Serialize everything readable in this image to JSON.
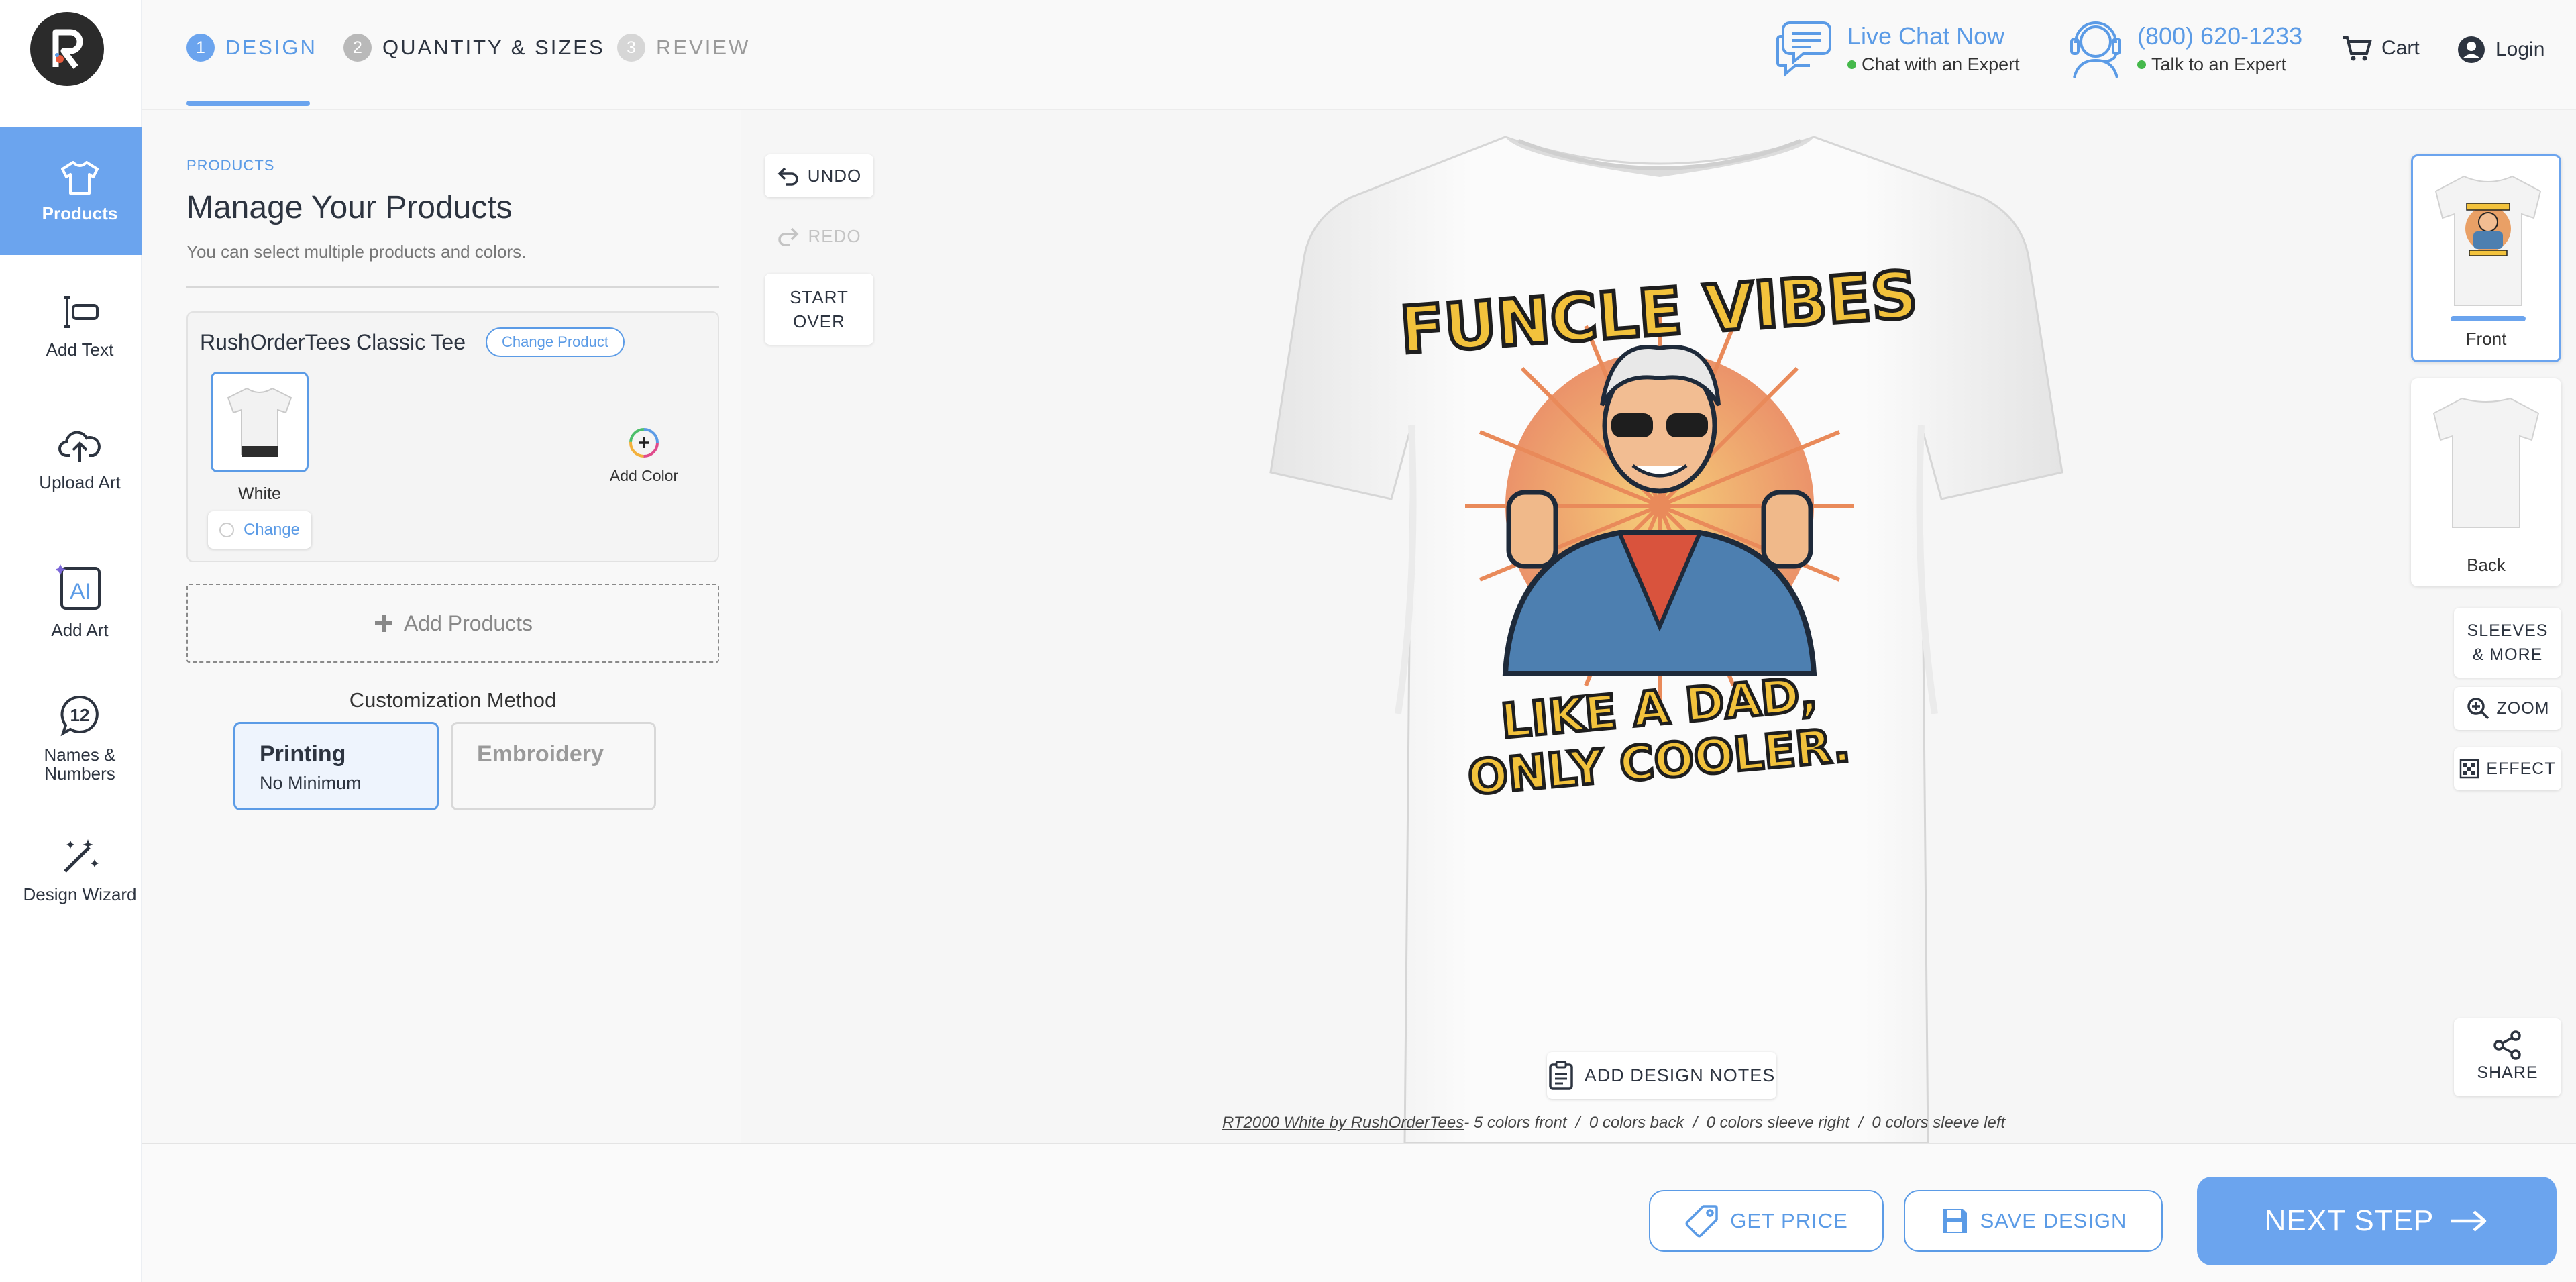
{
  "steps": [
    {
      "num": "1",
      "label": "DESIGN"
    },
    {
      "num": "2",
      "label": "QUANTITY & SIZES"
    },
    {
      "num": "3",
      "label": "REVIEW"
    }
  ],
  "header": {
    "chat": {
      "title": "Live Chat Now",
      "subtitle": "Chat with an Expert"
    },
    "phone": {
      "title": "(800) 620-1233",
      "subtitle": "Talk to an Expert"
    },
    "cart": "Cart",
    "login": "Login"
  },
  "sidebar": {
    "items": [
      {
        "label": "Products",
        "icon": "tshirt-icon"
      },
      {
        "label": "Add Text",
        "icon": "text-cursor-icon"
      },
      {
        "label": "Upload Art",
        "icon": "cloud-upload-icon"
      },
      {
        "label": "Add Art",
        "icon": "ai-icon",
        "icon_text": "AI"
      },
      {
        "label": "Names & Numbers",
        "icon": "number-badge-icon",
        "icon_text": "12"
      },
      {
        "label": "Design Wizard",
        "icon": "magic-wand-icon"
      }
    ]
  },
  "panel": {
    "crumb": "PRODUCTS",
    "title": "Manage Your Products",
    "subtitle": "You can select multiple products and colors.",
    "product_name": "RushOrderTees Classic Tee",
    "change_product": "Change Product",
    "color_label": "White",
    "change_color": "Change",
    "add_color": "Add Color",
    "add_products": "Add Products",
    "method_label": "Customization Method",
    "methods": [
      {
        "title": "Printing",
        "subtitle": "No Minimum"
      },
      {
        "title": "Embroidery",
        "subtitle": ""
      }
    ]
  },
  "canvas": {
    "undo": "UNDO",
    "redo": "REDO",
    "start_over_1": "START",
    "start_over_2": "OVER",
    "design_text_top": "FUNCLE VIBES",
    "design_text_bottom_1": "LIKE A DAD,",
    "design_text_bottom_2": "ONLY COOLER.",
    "views": [
      {
        "label": "Front"
      },
      {
        "label": "Back"
      }
    ],
    "sleeves_1": "SLEEVES",
    "sleeves_2": "& MORE",
    "zoom": "ZOOM",
    "effect": "EFFECT",
    "share": "SHARE",
    "design_notes": "ADD DESIGN NOTES",
    "summary_link": "RT2000 White by RushOrderTees",
    "summary_rest": "- 5 colors front  /  0 colors back  /  0 colors sleeve right  /  0 colors sleeve left"
  },
  "actions": {
    "get_price": "GET PRICE",
    "save_design": "SAVE DESIGN",
    "next_step": "NEXT STEP"
  },
  "colors": {
    "accent": "#6ba4ee",
    "link": "#5b9be6",
    "online": "#46b94c",
    "design_yellow": "#f2c23c",
    "jacket_blue": "#4d7fb0",
    "shirt_red": "#d9533d"
  }
}
